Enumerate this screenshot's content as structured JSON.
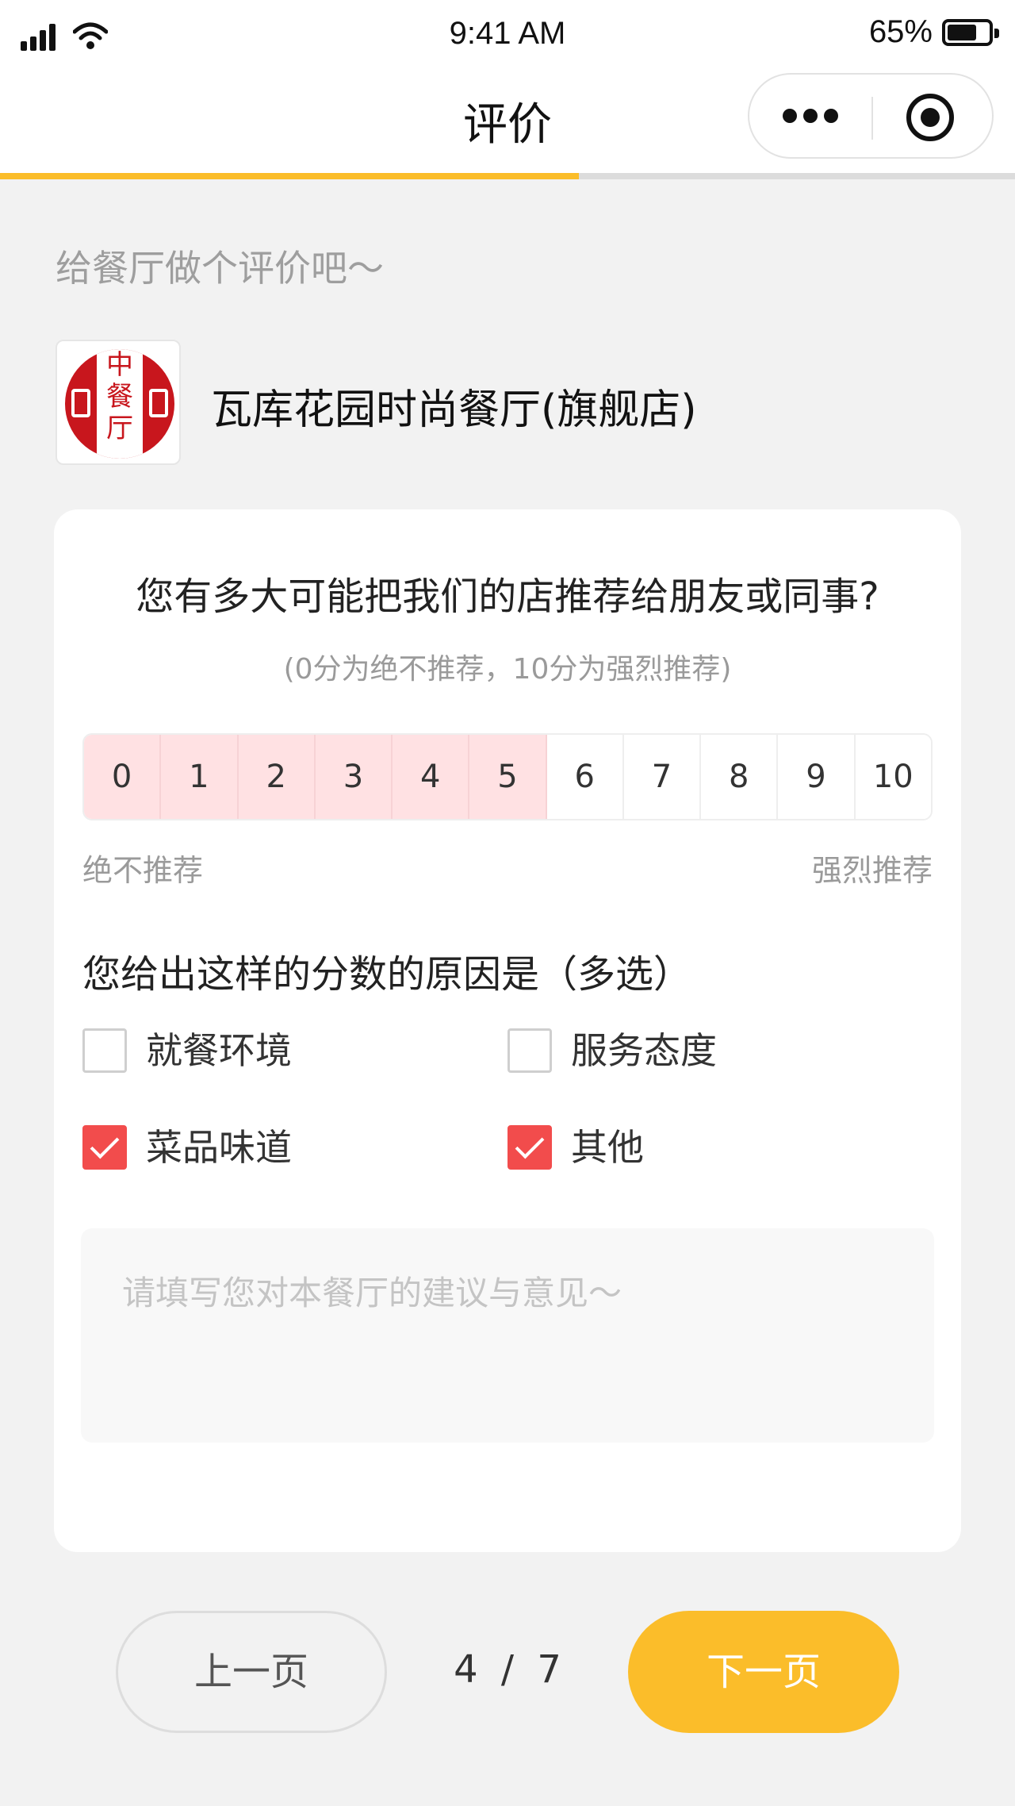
{
  "status_bar": {
    "time": "9:41 AM",
    "battery": "65%"
  },
  "nav": {
    "title": "评价"
  },
  "progress": {
    "value": 0.57
  },
  "intro": "给餐厅做个评价吧～",
  "restaurant": {
    "logo_text": [
      "中",
      "餐",
      "厅"
    ],
    "name": "瓦库花园时尚餐厅(旗舰店)"
  },
  "nps": {
    "question": "您有多大可能把我们的店推荐给朋友或同事?",
    "hint": "(0分为绝不推荐，10分为强烈推荐)",
    "scale": [
      "0",
      "1",
      "2",
      "3",
      "4",
      "5",
      "6",
      "7",
      "8",
      "9",
      "10"
    ],
    "selected": 5,
    "low_label": "绝不推荐",
    "high_label": "强烈推荐",
    "highlight_color": "#ffe1e3"
  },
  "reasons": {
    "question": "您给出这样的分数的原因是（多选）",
    "options": [
      {
        "label": "就餐环境",
        "checked": false
      },
      {
        "label": "服务态度",
        "checked": false
      },
      {
        "label": "菜品味道",
        "checked": true
      },
      {
        "label": "其他",
        "checked": true
      }
    ],
    "check_color": "#f24c4c"
  },
  "feedback": {
    "placeholder": "请填写您对本餐厅的建议与意见～",
    "value": ""
  },
  "footer": {
    "prev_label": "上一页",
    "page_current": "4",
    "page_sep": "/",
    "page_total": "7",
    "next_label": "下一页",
    "accent_color": "#fbbd2a"
  }
}
